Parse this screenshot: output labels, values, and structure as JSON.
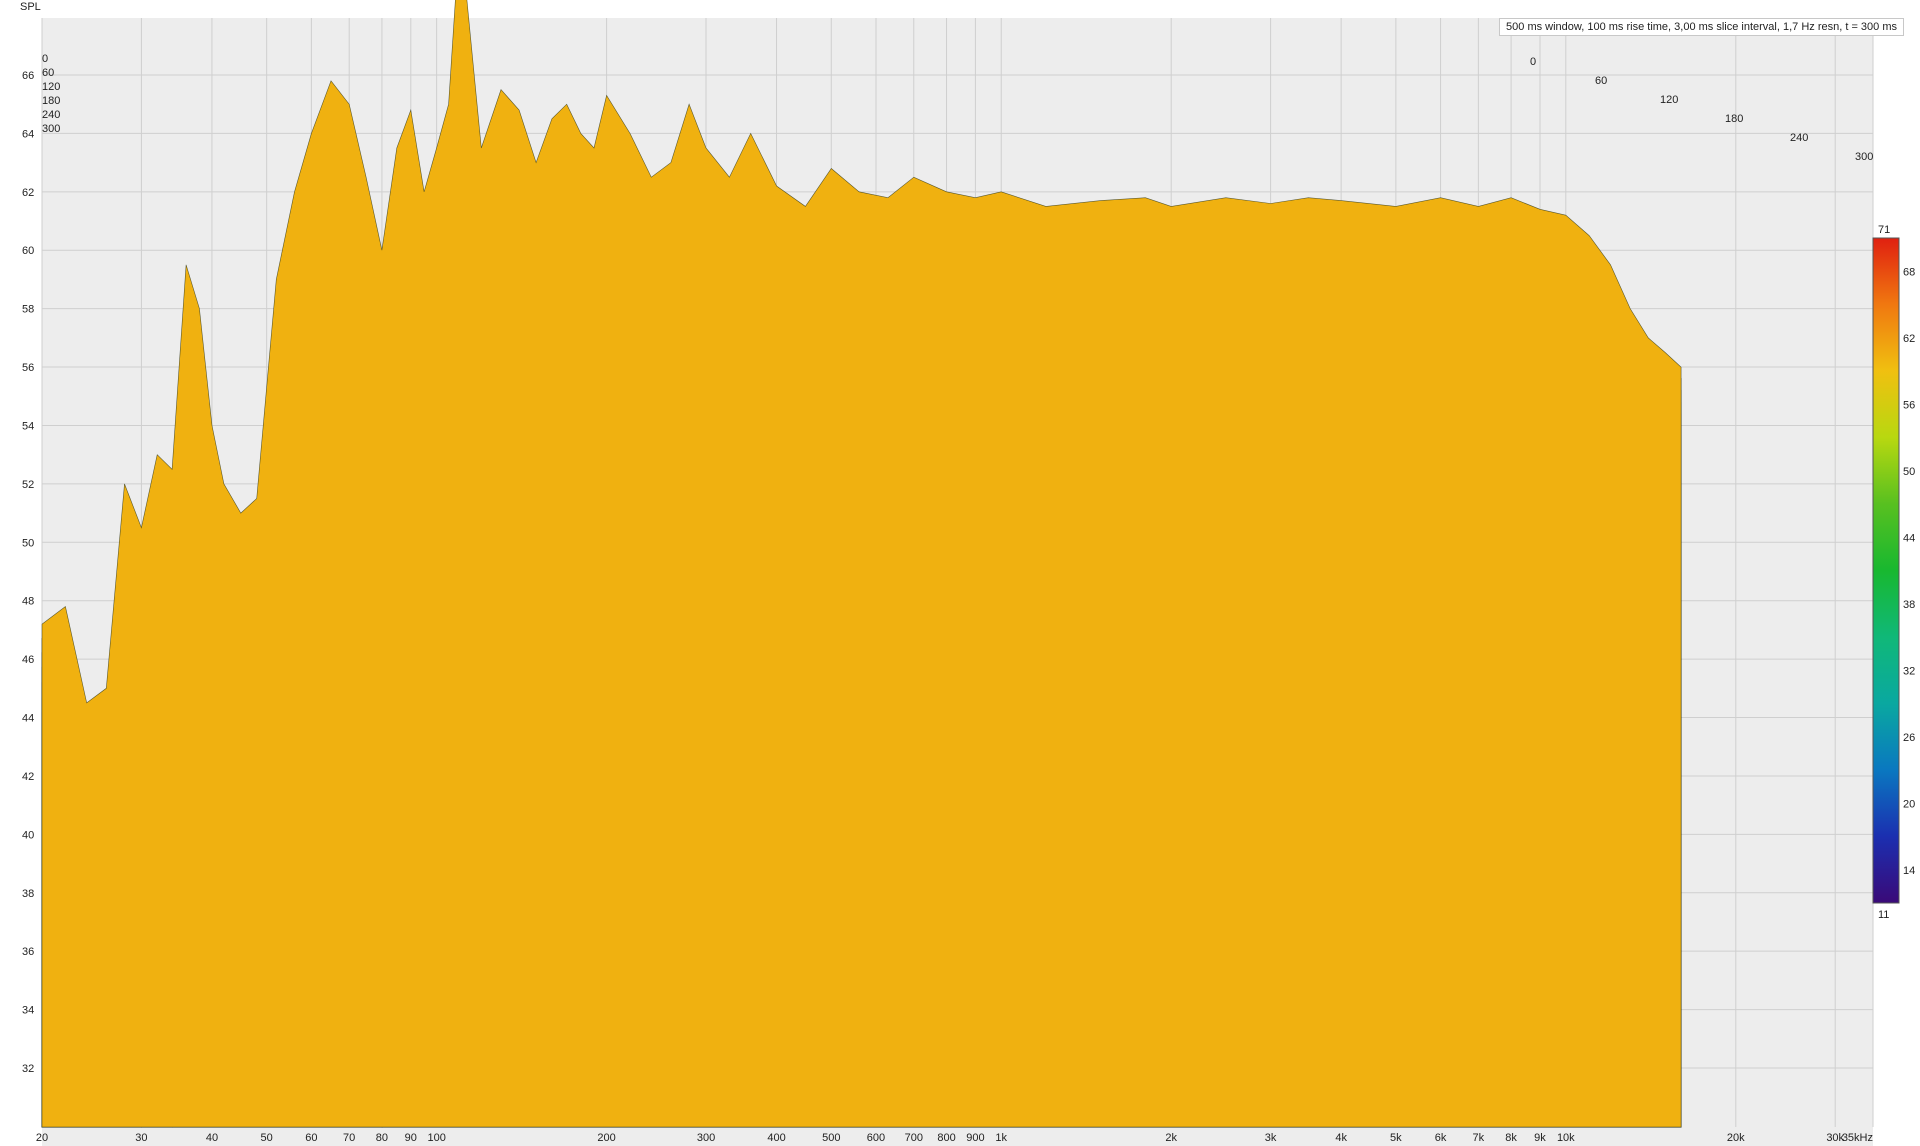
{
  "info_text": "500 ms window, 100 ms rise time, 3,00 ms slice interval, 1,7 Hz resn, t = 300 ms",
  "colors": {
    "background": "#ffffff",
    "plot_bg": "#ededed",
    "grid": "#cfcfcf",
    "slice_outline": "#1e2a10",
    "accent_peak": "#e03a10"
  },
  "chart_data": {
    "type": "waterfall",
    "ylabel": "SPL",
    "xlabel_unit": "kHz",
    "x_scale": "log",
    "xlim": [
      20,
      35000
    ],
    "ylim": [
      30,
      68
    ],
    "time_ms_range": [
      0,
      300
    ],
    "x_ticks": [
      "20",
      "30",
      "40",
      "50",
      "60",
      "70",
      "80",
      "90",
      "100",
      "200",
      "300",
      "400",
      "500",
      "600",
      "700",
      "800",
      "900",
      "1k",
      "2k",
      "3k",
      "4k",
      "5k",
      "6k",
      "7k",
      "8k",
      "9k",
      "10k",
      "20k",
      "30k",
      "35kHz"
    ],
    "x_tick_values": [
      20,
      30,
      40,
      50,
      60,
      70,
      80,
      90,
      100,
      200,
      300,
      400,
      500,
      600,
      700,
      800,
      900,
      1000,
      2000,
      3000,
      4000,
      5000,
      6000,
      7000,
      8000,
      9000,
      10000,
      20000,
      30000,
      35000
    ],
    "y_ticks": [
      32,
      34,
      36,
      38,
      40,
      42,
      44,
      46,
      48,
      50,
      52,
      54,
      56,
      58,
      60,
      62,
      64,
      66
    ],
    "time_ticks": [
      "0",
      "60",
      "120",
      "180",
      "240",
      "300"
    ],
    "colorbar": {
      "min": 11,
      "max": 71,
      "ticks": [
        14,
        20,
        26,
        32,
        38,
        44,
        50,
        56,
        62,
        68
      ],
      "min_label": "11",
      "max_label": "71",
      "stops": [
        "#3a0a78",
        "#1b2fb0",
        "#0a78c0",
        "#0aa8a0",
        "#10b878",
        "#18b830",
        "#58c020",
        "#b8d810",
        "#f0c010",
        "#f07810",
        "#e02010"
      ]
    },
    "front_slice": {
      "freq": [
        20,
        22,
        24,
        26,
        28,
        30,
        32,
        34,
        36,
        38,
        40,
        42,
        45,
        48,
        52,
        56,
        60,
        65,
        70,
        75,
        80,
        85,
        90,
        95,
        100,
        105,
        110,
        120,
        130,
        140,
        150,
        160,
        170,
        180,
        190,
        200,
        220,
        240,
        260,
        280,
        300,
        330,
        360,
        400,
        450,
        500,
        560,
        630,
        700,
        800,
        900,
        1000,
        1200,
        1500,
        1800,
        2000,
        2500,
        3000,
        3500,
        4000,
        5000,
        6000,
        7000,
        8000,
        9000,
        10000,
        11000,
        12000,
        13000,
        14000,
        15000,
        16000
      ],
      "spl": [
        47.2,
        47.8,
        44.5,
        45.0,
        52.0,
        50.5,
        53.0,
        52.5,
        59.5,
        58.0,
        54.0,
        52.0,
        51.0,
        51.5,
        59.0,
        62.0,
        64.0,
        65.8,
        65.0,
        62.5,
        60.0,
        63.5,
        64.8,
        62.0,
        63.5,
        65.0,
        71.0,
        63.5,
        65.5,
        64.8,
        63.0,
        64.5,
        65.0,
        64.0,
        63.5,
        65.3,
        64.0,
        62.5,
        63.0,
        65.0,
        63.5,
        62.5,
        64.0,
        62.2,
        61.5,
        62.8,
        62.0,
        61.8,
        62.5,
        62.0,
        61.8,
        62.0,
        61.5,
        61.7,
        61.8,
        61.5,
        61.8,
        61.6,
        61.8,
        61.7,
        61.5,
        61.8,
        61.5,
        61.8,
        61.4,
        61.2,
        60.5,
        59.5,
        58.0,
        57.0,
        56.5,
        56.0
      ]
    }
  }
}
